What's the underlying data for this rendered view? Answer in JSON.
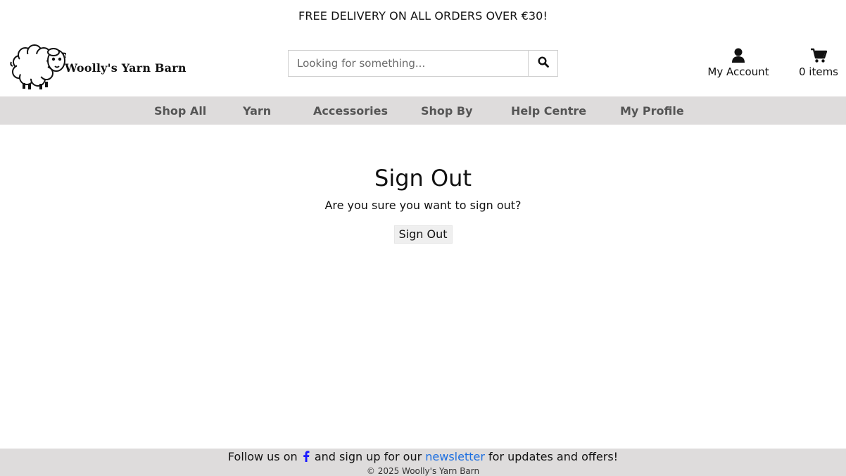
{
  "promo": {
    "text": "FREE DELIVERY ON ALL ORDERS OVER €30!"
  },
  "header": {
    "logo_text": "Woolly's Yarn Barn",
    "logo_icon": "sheep-icon",
    "search": {
      "placeholder": "Looking for something...",
      "value": "",
      "button_icon": "search-icon"
    },
    "account": {
      "label": "My Account",
      "icon": "user-icon"
    },
    "cart": {
      "label": "0 items",
      "icon": "cart-icon"
    }
  },
  "nav": {
    "items": [
      {
        "label": "Shop All"
      },
      {
        "label": "Yarn"
      },
      {
        "label": "Accessories"
      },
      {
        "label": "Shop By"
      },
      {
        "label": "Help Centre"
      },
      {
        "label": "My Profile"
      }
    ]
  },
  "main": {
    "title": "Sign Out",
    "message": "Are you sure you want to sign out?",
    "button_label": "Sign Out"
  },
  "footer": {
    "follow_prefix": "Follow us on",
    "facebook_icon": "facebook-icon",
    "follow_middle": "and sign up for our",
    "newsletter_link": "newsletter",
    "follow_suffix": "for updates and offers!",
    "copyright": "© 2025 Woolly's Yarn Barn"
  },
  "colors": {
    "nav_background": "#dedcdc",
    "nav_text": "#555555",
    "link": "#1d6fe0",
    "facebook": "#1a1aff"
  }
}
